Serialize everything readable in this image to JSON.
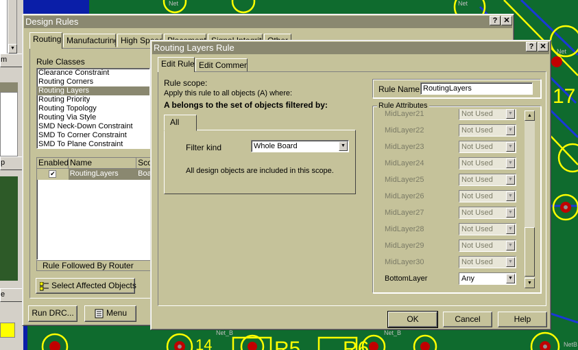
{
  "left_strip": {
    "btn_top": "m",
    "btn_mid": "p",
    "btn_low": "e"
  },
  "pcb": {
    "net_labels": [
      "Net",
      "Net",
      "Net",
      "NetB",
      "Net_B",
      "Net_B"
    ],
    "big_number": "17",
    "silk_left": "14",
    "silk_r5": "R5",
    "silk_r6": "R6"
  },
  "design_rules": {
    "title": "Design Rules",
    "help_btn": "?",
    "close_btn": "✕",
    "tabs": [
      "Routing",
      "Manufacturing",
      "High Speed",
      "Placement",
      "Signal Integrity",
      "Other"
    ],
    "rule_classes_header": "Rule Classes",
    "rule_classes": [
      "Clearance Constraint",
      "Routing Corners",
      "Routing Layers",
      "Routing Priority",
      "Routing Topology",
      "Routing Via Style",
      "SMD Neck-Down Constraint",
      "SMD To Corner Constraint",
      "SMD To Plane Constraint"
    ],
    "selected_class_index": 2,
    "rules_table": {
      "columns": [
        "Enabled",
        "Name",
        "Sco"
      ],
      "rows": [
        {
          "enabled": "✔",
          "name": "RoutingLayers",
          "scope": "Boa"
        }
      ]
    },
    "rule_followed_by": "Rule Followed By Router",
    "select_affected_btn": "Select Affected Objects",
    "run_drc_btn": "Run DRC...",
    "menu_btn": "Menu"
  },
  "routing_layers_rule": {
    "title": "Routing Layers Rule",
    "help_btn": "?",
    "close_btn": "✕",
    "tabs": [
      "Edit Rule",
      "Edit Comment"
    ],
    "rule_scope_label": "Rule scope:",
    "apply_text": "Apply this rule to all objects (A) where:",
    "belongs_text": "A belongs to the set of objects filtered by:",
    "scope_tab": "All",
    "filter_kind_label": "Filter kind",
    "filter_kind_value": "Whole Board",
    "scope_desc": "All design objects are included in this scope.",
    "rule_name_label": "Rule Name",
    "rule_name_value": "RoutingLayers",
    "rule_attributes_label": "Rule Attributes",
    "layers": [
      {
        "name": "MidLayer21",
        "value": "Not Used",
        "enabled": false
      },
      {
        "name": "MidLayer22",
        "value": "Not Used",
        "enabled": false
      },
      {
        "name": "MidLayer23",
        "value": "Not Used",
        "enabled": false
      },
      {
        "name": "MidLayer24",
        "value": "Not Used",
        "enabled": false
      },
      {
        "name": "MidLayer25",
        "value": "Not Used",
        "enabled": false
      },
      {
        "name": "MidLayer26",
        "value": "Not Used",
        "enabled": false
      },
      {
        "name": "MidLayer27",
        "value": "Not Used",
        "enabled": false
      },
      {
        "name": "MidLayer28",
        "value": "Not Used",
        "enabled": false
      },
      {
        "name": "MidLayer29",
        "value": "Not Used",
        "enabled": false
      },
      {
        "name": "MidLayer30",
        "value": "Not Used",
        "enabled": false
      },
      {
        "name": "BottomLayer",
        "value": "Any",
        "enabled": true
      }
    ],
    "ok_btn": "OK",
    "cancel_btn": "Cancel",
    "help_text_btn": "Help"
  }
}
